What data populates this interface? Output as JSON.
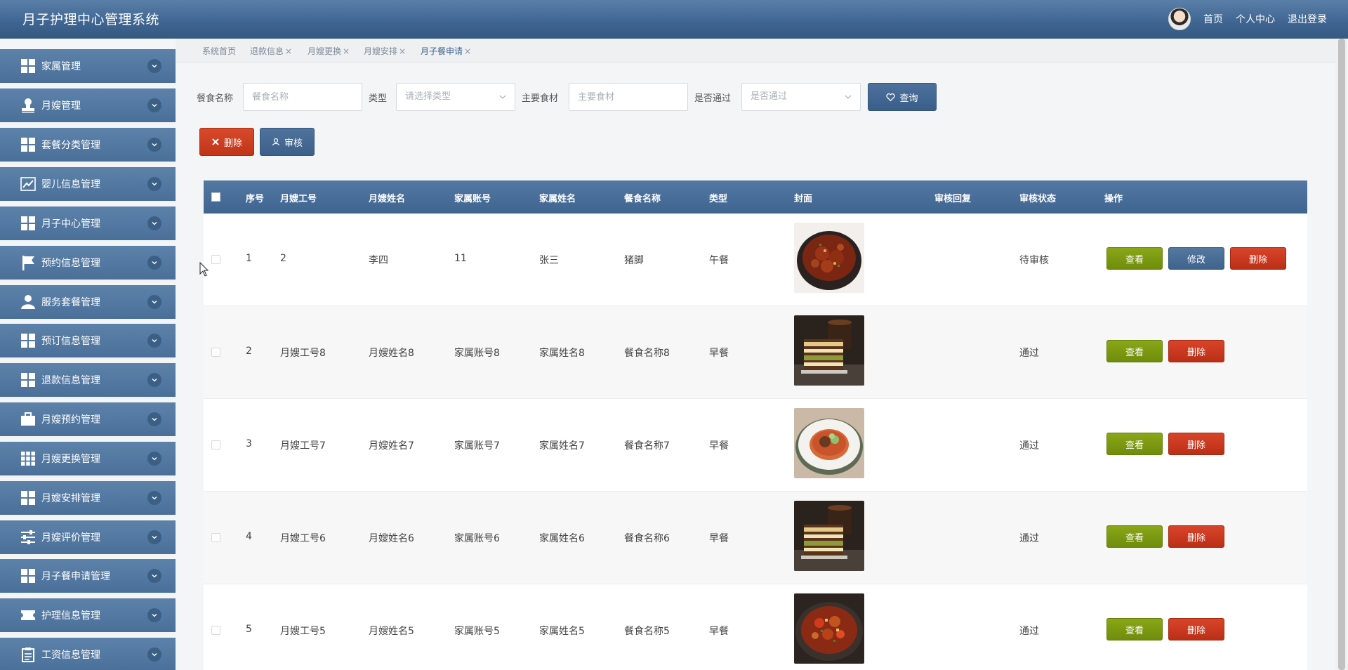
{
  "app": {
    "title": "月子护理中心管理系统"
  },
  "header": {
    "home": "首页",
    "profile": "个人中心",
    "logout": "退出登录"
  },
  "sidebar": {
    "items": [
      {
        "label": "家属管理",
        "icon": "grid-icon"
      },
      {
        "label": "月嫂管理",
        "icon": "stamp-icon"
      },
      {
        "label": "套餐分类管理",
        "icon": "grid-icon"
      },
      {
        "label": "婴儿信息管理",
        "icon": "chart-icon"
      },
      {
        "label": "月子中心管理",
        "icon": "grid-icon"
      },
      {
        "label": "预约信息管理",
        "icon": "flag-icon"
      },
      {
        "label": "服务套餐管理",
        "icon": "user-icon"
      },
      {
        "label": "预订信息管理",
        "icon": "grid-icon"
      },
      {
        "label": "退款信息管理",
        "icon": "grid-icon"
      },
      {
        "label": "月嫂预约管理",
        "icon": "briefcase-icon"
      },
      {
        "label": "月嫂更换管理",
        "icon": "apps-icon"
      },
      {
        "label": "月嫂安排管理",
        "icon": "grid-icon"
      },
      {
        "label": "月嫂评价管理",
        "icon": "sliders-icon"
      },
      {
        "label": "月子餐申请管理",
        "icon": "grid-icon"
      },
      {
        "label": "护理信息管理",
        "icon": "ticket-icon"
      },
      {
        "label": "工资信息管理",
        "icon": "clipboard-icon"
      }
    ]
  },
  "tabs": [
    {
      "label": "系统首页",
      "closable": false
    },
    {
      "label": "退款信息",
      "closable": true
    },
    {
      "label": "月嫂更换",
      "closable": true
    },
    {
      "label": "月嫂安排",
      "closable": true
    },
    {
      "label": "月子餐申请",
      "closable": true,
      "active": true
    }
  ],
  "search": {
    "meal_name_label": "餐食名称",
    "meal_name_placeholder": "餐食名称",
    "type_label": "类型",
    "type_placeholder": "请选择类型",
    "ingredient_label": "主要食材",
    "ingredient_placeholder": "主要食材",
    "pass_label": "是否通过",
    "pass_placeholder": "是否通过",
    "query_button": "查询"
  },
  "actions": {
    "delete_button": "删除",
    "audit_button": "审核"
  },
  "table": {
    "columns": [
      "序号",
      "月嫂工号",
      "月嫂姓名",
      "家属账号",
      "家属姓名",
      "餐食名称",
      "类型",
      "封面",
      "审核回复",
      "审核状态",
      "操作"
    ],
    "rows": [
      {
        "no": "1",
        "staff_id": "2",
        "staff_name": "李四",
        "family_account": "11",
        "family_name": "张三",
        "meal": "猪脚",
        "type": "午餐",
        "reply": "",
        "status": "待审核",
        "cover": "braised-meat",
        "editable": true
      },
      {
        "no": "2",
        "staff_id": "月嫂工号8",
        "staff_name": "月嫂姓名8",
        "family_account": "家属账号8",
        "family_name": "家属姓名8",
        "meal": "餐食名称8",
        "type": "早餐",
        "reply": "",
        "status": "通过",
        "cover": "layer-cake",
        "editable": false
      },
      {
        "no": "3",
        "staff_id": "月嫂工号7",
        "staff_name": "月嫂姓名7",
        "family_account": "家属账号7",
        "family_name": "家属姓名7",
        "meal": "餐食名称7",
        "type": "早餐",
        "reply": "",
        "status": "通过",
        "cover": "plated-dish",
        "editable": false
      },
      {
        "no": "4",
        "staff_id": "月嫂工号6",
        "staff_name": "月嫂姓名6",
        "family_account": "家属账号6",
        "family_name": "家属姓名6",
        "meal": "餐食名称6",
        "type": "早餐",
        "reply": "",
        "status": "通过",
        "cover": "layer-cake",
        "editable": false
      },
      {
        "no": "5",
        "staff_id": "月嫂工号5",
        "staff_name": "月嫂姓名5",
        "family_account": "家属账号5",
        "family_name": "家属姓名5",
        "meal": "餐食名称5",
        "type": "早餐",
        "reply": "",
        "status": "通过",
        "cover": "stir-fry",
        "editable": false
      }
    ],
    "row_buttons": {
      "view": "查看",
      "edit": "修改",
      "delete": "删除"
    }
  },
  "colors": {
    "primary": "#3f6490",
    "danger": "#c13419",
    "success": "#7a970f"
  }
}
